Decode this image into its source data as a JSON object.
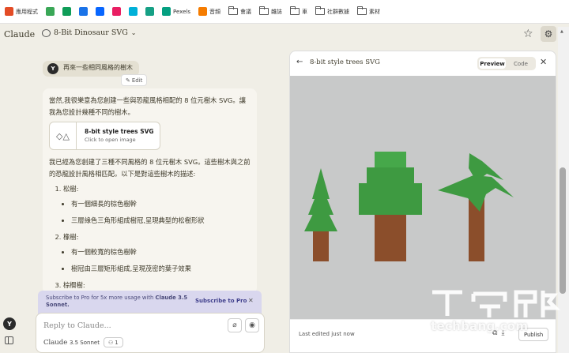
{
  "bookmarks": [
    {
      "label": "應用程式",
      "icon": "apps-grid-icon",
      "color": "#e34c26"
    },
    {
      "label": "",
      "icon": "puzzle-icon",
      "color": "#3aa757"
    },
    {
      "label": "",
      "icon": "sheets-icon",
      "color": "#0f9d58"
    },
    {
      "label": "",
      "icon": "c-logo-icon",
      "color": "#1a73e8"
    },
    {
      "label": "",
      "icon": "meta-icon",
      "color": "#0866ff"
    },
    {
      "label": "",
      "icon": "music-icon",
      "color": "#e91e63"
    },
    {
      "label": "",
      "icon": "app-icon",
      "color": "#00b0d8"
    },
    {
      "label": "",
      "icon": "notion-icon",
      "color": "#16a085"
    },
    {
      "label": "Pexels",
      "icon": "pexels-icon",
      "color": "#05a081"
    },
    {
      "label": "音頻",
      "icon": "audio-wave-icon",
      "color": "#f57c00"
    },
    {
      "label": "會議",
      "icon": "folder-icon",
      "color": ""
    },
    {
      "label": "雜誌",
      "icon": "folder-icon",
      "color": ""
    },
    {
      "label": "車",
      "icon": "folder-icon",
      "color": ""
    },
    {
      "label": "社群數據",
      "icon": "folder-icon",
      "color": ""
    },
    {
      "label": "素材",
      "icon": "folder-icon",
      "color": ""
    }
  ],
  "header": {
    "app_name": "Claude",
    "chat_title": "8-Bit Dinosaur SVG"
  },
  "user_message": {
    "avatar": "Y",
    "text": "再來一些相同風格的樹木",
    "edit_label": "Edit"
  },
  "assistant": {
    "intro": "當然,我很樂意為您創建一些與恐龍風格相配的 8 位元樹木 SVG。讓我為您設計幾種不同的樹木。",
    "artifact_title": "8-bit style trees SVG",
    "artifact_sub": "Click to open image",
    "para2": "我已經為您創建了三種不同風格的 8 位元樹木 SVG。這些樹木與之前的恐龍設計風格相匹配。以下是對這些樹木的描述:",
    "items": [
      {
        "title": "松樹:",
        "subs": [
          "有一個細長的棕色樹幹",
          "三層綠色三角形組成樹冠,呈現典型的松樹形狀"
        ]
      },
      {
        "title": "橡樹:",
        "subs": [
          "有一個較寬的棕色樹幹",
          "樹冠由三層矩形組成,呈現茂密的葉子效果"
        ]
      },
      {
        "title": "棕櫚樹:",
        "subs": []
      }
    ]
  },
  "promo": {
    "text_a": "Subscribe to Pro for 5x more usage with ",
    "text_b": "Claude 3.5",
    "text_c": "Sonnet.",
    "cta": "Subscribe to Pro"
  },
  "composer": {
    "placeholder": "Reply to Claude...",
    "model_name": "Claude",
    "model_version": "3.5 Sonnet",
    "attachment_count": "1"
  },
  "panel": {
    "title": "8-bit style trees SVG",
    "tab_preview": "Preview",
    "tab_code": "Code",
    "last_edited": "Last edited just now",
    "publish": "Publish",
    "bg_color": "#c8c9c9",
    "trunk_color": "#8b4e2b",
    "leaf_color": "#3e9a41",
    "leaf_light": "#46a84a"
  },
  "watermark": {
    "logo_text": "T客邦",
    "domain": "techbang.com"
  }
}
